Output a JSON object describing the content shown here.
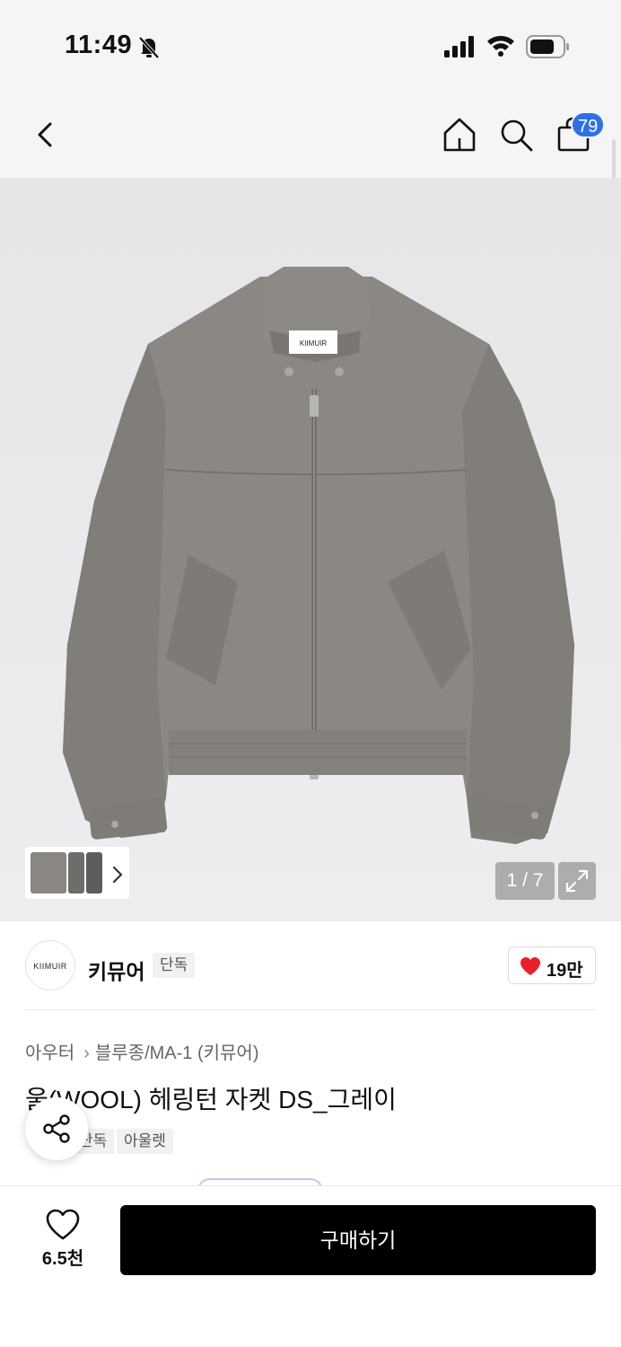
{
  "status_bar": {
    "time": "11:49",
    "icons": [
      "bell-slash-icon",
      "signal-icon",
      "wifi-icon",
      "battery-icon"
    ]
  },
  "nav": {
    "back_icon": "chevron-left-icon",
    "home_icon": "home-icon",
    "search_icon": "search-icon",
    "cart_icon": "shopping-bag-icon",
    "cart_badge": "79",
    "badge_color": "#2f6fe8"
  },
  "gallery": {
    "counter": "1 / 7",
    "expand_icon": "expand-icon",
    "next_icon": "chevron-right-icon",
    "label_text": "KIIMUIR"
  },
  "brand": {
    "logo_text": "KIIMUIR",
    "name": "키뮤어",
    "tag": "단독",
    "likes": "19만",
    "like_color": "#e8202a"
  },
  "product": {
    "breadcrumb": [
      "아우터",
      "블루종/MA-1 (키뮤어)"
    ],
    "title": "울(WOOL) 헤링턴 자켓 DS_그레이",
    "tags": [
      "단독",
      "아울렛"
    ]
  },
  "bottom": {
    "wish_count": "6.5천",
    "buy_label": "구매하기"
  }
}
